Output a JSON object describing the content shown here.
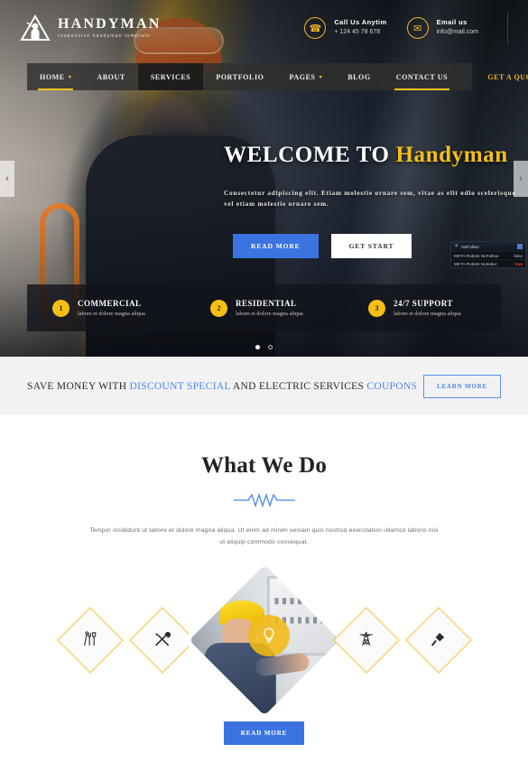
{
  "header": {
    "logo": {
      "icon": "handyman-triangle-logo-icon",
      "title": "HANDYMAN",
      "tagline": "responsive handyman template"
    },
    "contacts": [
      {
        "icon": "phone-icon",
        "title": "Call Us Anytim",
        "value": "+ 124 45 78 678"
      },
      {
        "icon": "envelope-icon",
        "title": "Email us",
        "value": "info@mail.com"
      }
    ]
  },
  "nav": {
    "items": [
      {
        "label": "HOME",
        "caret": "▾",
        "has_caret": true,
        "underline": true,
        "active_bg": false,
        "highlight": false
      },
      {
        "label": "ABOUT",
        "caret": "",
        "has_caret": false,
        "underline": false,
        "active_bg": false,
        "highlight": false
      },
      {
        "label": "SERVICES",
        "caret": "",
        "has_caret": false,
        "underline": false,
        "active_bg": true,
        "highlight": false
      },
      {
        "label": "PORTFOLIO",
        "caret": "",
        "has_caret": false,
        "underline": false,
        "active_bg": false,
        "highlight": false
      },
      {
        "label": "PAGES",
        "caret": "▾",
        "has_caret": true,
        "underline": false,
        "active_bg": false,
        "highlight": false
      },
      {
        "label": "BLOG",
        "caret": "",
        "has_caret": false,
        "underline": false,
        "active_bg": false,
        "highlight": false
      },
      {
        "label": "CONTACT US",
        "caret": "",
        "has_caret": false,
        "underline": true,
        "active_bg": false,
        "highlight": false
      },
      {
        "label": "GET A QUOTES",
        "caret": "",
        "has_caret": false,
        "underline": false,
        "active_bg": false,
        "highlight": true
      }
    ]
  },
  "hero": {
    "title_plain": "WELCOME TO",
    "title_accent": "Handyman",
    "subtitle": "Consectetur adipiscing elit. Etiam molestie ornare sem, vitae as elit odio scelerisque vel etiam molestie ornare sem.",
    "primary_button": "READ MORE",
    "secondary_button": "GET START",
    "arrow_left": "‹",
    "arrow_right": "›",
    "dots": [
      {
        "active": true
      },
      {
        "active": false
      }
    ]
  },
  "seo_panel": {
    "title": "NoFollow",
    "rows": [
      {
        "label": "META-Robots NoFollow:",
        "value": "false",
        "red": false
      },
      {
        "label": "META-Robots NoIndex:",
        "value": "true",
        "red": true
      }
    ]
  },
  "features": [
    {
      "number": "1",
      "title": "COMMERCIAL",
      "subtitle": "labore et dolore magna aliqua"
    },
    {
      "number": "2",
      "title": "RESIDENTIAL",
      "subtitle": "labore et dolore magna aliqua"
    },
    {
      "number": "3",
      "title": "24/7 SUPPORT",
      "subtitle": "labore et dolore magna aliqua"
    }
  ],
  "coupon_bar": {
    "part1": "SAVE MONEY WITH ",
    "link1": "DISCOUNT SPECIAL",
    "part2": " AND ELECTRIC SERVICES ",
    "link2": "COUPONS",
    "button": "LEARN MORE"
  },
  "what_we_do": {
    "title": "What We Do",
    "divider": "zigzag-wave-divider",
    "description": "Tempor incididunt ut labore et dolore magna aliqua. Ut enim ad minim veniam quis nostrud exercitation ullamco laboris nisi ut aliquip commodo consequat.",
    "services": [
      {
        "icon": "tools-set-icon",
        "glyph": "⌇"
      },
      {
        "icon": "screwdriver-wrench-cross-icon",
        "glyph": "⚒"
      },
      {
        "icon": "electrician-photo",
        "glyph": ""
      },
      {
        "icon": "power-tower-icon",
        "glyph": "⛯"
      },
      {
        "icon": "screwdriver-icon",
        "glyph": "✎"
      }
    ],
    "center_badge_icon": "lightbulb-icon",
    "center_badge_glyph": "Ὂ1",
    "button": "READ MORE"
  },
  "colors": {
    "accent_yellow": "#f5bf15",
    "accent_blue": "#3b74e0",
    "link_blue": "#4b87ef",
    "dark": "#1c1c1c"
  }
}
